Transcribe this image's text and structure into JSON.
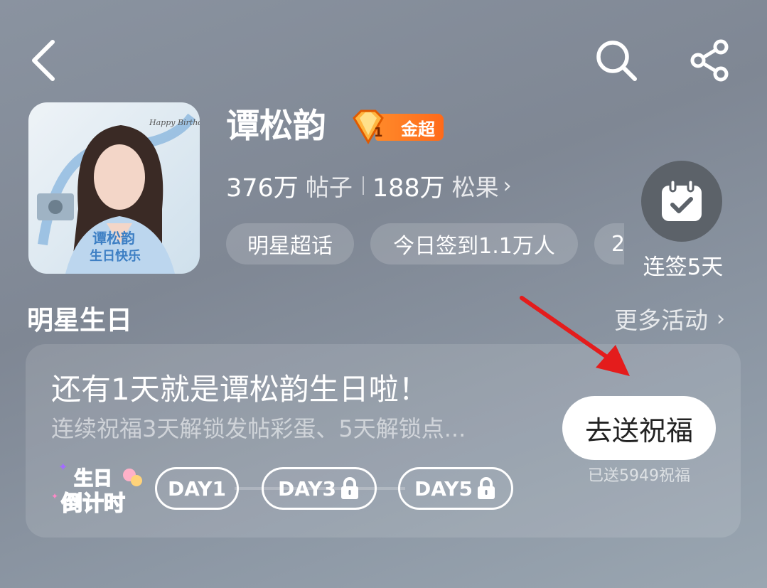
{
  "topbar": {
    "back_icon": "chevron-left-icon",
    "search_icon": "search-icon",
    "share_icon": "share-icon"
  },
  "profile": {
    "name": "谭松韵",
    "badge_level": "1",
    "badge_label": "金超",
    "posts_count": "376万",
    "posts_label": "帖子",
    "fans_count": "188万",
    "fans_label": "松果",
    "tags": [
      "明星超话",
      "今日签到1.1万人",
      "2"
    ],
    "checkin_label": "连签5天",
    "avatar_texts": {
      "caption": "谭松韵\n生日快乐",
      "happy_birthday": "Happy Birthday"
    }
  },
  "section": {
    "title": "明星生日",
    "more_label": "更多活动"
  },
  "birthday_card": {
    "title": "还有1天就是谭松韵生日啦！",
    "subtitle": "连续祝福3天解锁发帖彩蛋、5天解锁点...",
    "send_button": "去送祝福",
    "sent_count": "已送5949祝福",
    "countdown_line1": "生日",
    "countdown_line2": "倒计时",
    "days": [
      "DAY1",
      "DAY3",
      "DAY5"
    ]
  },
  "colors": {
    "badge_orange": "#ff7a22",
    "annotation_arrow": "#e41c1c",
    "checkin_circle": "#5c6269"
  }
}
